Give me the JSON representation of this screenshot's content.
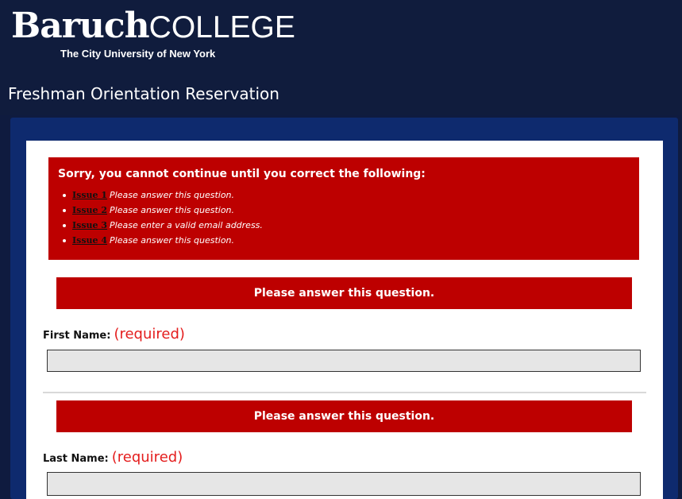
{
  "logo": {
    "brand": "Baruch",
    "college": "COLLEGE",
    "tagline": "The City University of New York"
  },
  "page_title": "Freshman Orientation Reservation",
  "error_summary": {
    "title": "Sorry, you cannot continue until you correct the following:",
    "issues": [
      {
        "link": "Issue 1",
        "message": "Please answer this question."
      },
      {
        "link": "Issue 2",
        "message": "Please answer this question."
      },
      {
        "link": "Issue 3",
        "message": "Please enter a valid email address."
      },
      {
        "link": "Issue 4",
        "message": "Please answer this question."
      }
    ]
  },
  "fields": [
    {
      "error": "Please answer this question.",
      "label": "First Name:",
      "required": "(required)",
      "value": ""
    },
    {
      "error": "Please answer this question.",
      "label": "Last Name:",
      "required": "(required)",
      "value": ""
    }
  ],
  "colors": {
    "header": "#101c3d",
    "panel": "#0e2a6e",
    "error": "#bd0000",
    "required": "#e41d1d",
    "input": "#e6e6e6"
  }
}
